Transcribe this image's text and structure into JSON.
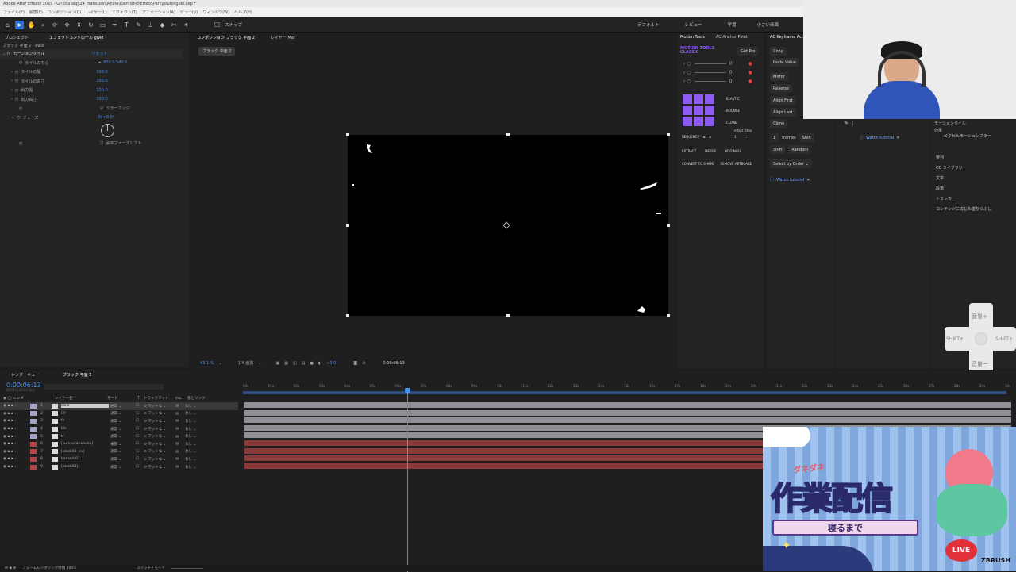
{
  "titlebar": {
    "title": "Adobe After Effects 2025 - G:\\Kita aiqg24 matsuzan\\AEefe\\Kamisinio\\Effect\\Parsys\\uiengeki.aep *"
  },
  "menu": [
    "ファイル(F)",
    "編集(E)",
    "コンポジション(C)",
    "レイヤー(L)",
    "エフェクト(T)",
    "アニメーション(A)",
    "ビュー(V)",
    "ウィンドウ(W)",
    "ヘルプ(H)"
  ],
  "toolbar": {
    "snap_label": "スナップ",
    "workspaces": [
      "デフォルト",
      "レビュー",
      "学習",
      "小さい画面"
    ]
  },
  "project_panel": {
    "tab1": "プロジェクト",
    "tab2": "エフェクトコントロール gwlo",
    "layer_path": "ブラック 平面 2 · ewlo"
  },
  "effect": {
    "name": "モーションタイル",
    "reset": "リセット",
    "props": [
      {
        "label": "タイルの中心",
        "value": "800.0,540.0"
      },
      {
        "label": "タイルの幅",
        "value": "100.0"
      },
      {
        "label": "タイルの高さ",
        "value": "100.0"
      },
      {
        "label": "出力幅",
        "value": "100.0"
      },
      {
        "label": "出力高さ",
        "value": "100.0"
      }
    ],
    "mirror": "ミラーエッジ",
    "phase_label": "フェーズ",
    "phase_value": "0x+0.0°",
    "hshift": "水平フェーズシフト"
  },
  "comp_panel": {
    "tab": "コンポジション ブラック 平面 2",
    "layer_tab": "レイヤー Mar",
    "chip": "ブラック 平面 2",
    "zoom": "43.1 %",
    "res": "1/4 画質",
    "exposure": "+0.0",
    "time": "0:00:06:13"
  },
  "motion_tools": {
    "tabs": [
      "Motion Tools",
      "AC Anchor Point"
    ],
    "brand": "MOTION TOOLS CLASSIC",
    "getpro": "Get Pro",
    "sliders": [
      "0",
      "0",
      "0"
    ],
    "side_labels": [
      "ELASTIC",
      "BOUNCE",
      "CLONE"
    ],
    "sequence": "SEQUENCE",
    "offset": "offset",
    "step": "step",
    "offset_val": "1",
    "step_val": "1",
    "row1": [
      "EXTRACT",
      "MERGE",
      "ADD NULL"
    ],
    "row2": [
      "CONVERT TO SHAPE",
      "REMOVE ARTBOARD"
    ]
  },
  "keyframe": {
    "tab": "AC Keyframe Act",
    "buttons": [
      "Copy",
      "Paste Value",
      "Mirror",
      "Reverse",
      "Align First",
      "Align Last",
      "Clone"
    ],
    "frames": "frames",
    "shift": "Shift",
    "random": "Random",
    "select_by": "Select by Order",
    "tutorial": "Watch tutorial",
    "frames_num": "1"
  },
  "extra_panel": {
    "tutorial": "Watch tutorial"
  },
  "right_list": {
    "header": "モーションタイル",
    "sub1": "効果",
    "sub2": "ピクセルモーションブラー",
    "items": [
      "整列",
      "CC ライブラリ",
      "文字",
      "段落",
      "トラッカー",
      "コンテンツに応じた塗りつぶし"
    ]
  },
  "overlay_pad": {
    "up": "音量+",
    "down": "音量ー",
    "left": "SHIFT+",
    "right": "SHIFT+"
  },
  "timeline": {
    "tab1": "レンダーキュー",
    "tab2": "ブラック 平面 2",
    "timecode": "0:00:06:13",
    "frame_info": "00193 (30.00 fps)",
    "col_layer": "レイヤー名",
    "col_mode": "モード",
    "col_t": "T",
    "col_matte": "トラックマット",
    "col_parent": "親とリンク",
    "ticks": [
      "00s",
      "01s",
      "02s",
      "03s",
      "04s",
      "05s",
      "06s",
      "07s",
      "08s",
      "09s",
      "10s",
      "11s",
      "12s",
      "13s",
      "14s",
      "15s",
      "16s",
      "17s",
      "18s",
      "19s",
      "20s",
      "21s",
      "22s",
      "23s",
      "24s",
      "25s",
      "26s",
      "27s",
      "28s",
      "29s",
      "30s"
    ],
    "layers": [
      {
        "num": "1",
        "name": "ewlo",
        "mode": "通常",
        "matte": "マットな",
        "parent": "なし",
        "color": "#a3a3c7"
      },
      {
        "num": "2",
        "name": "CP",
        "mode": "通常",
        "matte": "マットな",
        "parent": "なし",
        "color": "#a3a3c7"
      },
      {
        "num": "3",
        "name": "fh",
        "mode": "通常",
        "matte": "マットな",
        "parent": "なし",
        "color": "#a3a3c7"
      },
      {
        "num": "4",
        "name": "ble",
        "mode": "通常",
        "matte": "マットな",
        "parent": "なし",
        "color": "#a3a3c7"
      },
      {
        "num": "5",
        "name": "tf",
        "mode": "通常",
        "matte": "マットな",
        "parent": "なし",
        "color": "#a3a3c7"
      },
      {
        "num": "6",
        "name": "[kurokutarunoizu]",
        "mode": "乗算",
        "matte": "マットな",
        "parent": "なし",
        "color": "#b54545"
      },
      {
        "num": "7",
        "name": "[black03 .ex]",
        "mode": "通常",
        "matte": "マットな",
        "parent": "なし",
        "color": "#b54545"
      },
      {
        "num": "8",
        "name": "bamack01",
        "mode": "通常",
        "matte": "マットな",
        "parent": "なし",
        "color": "#b54545"
      },
      {
        "num": "9",
        "name": "[black02]",
        "mode": "通常",
        "matte": "マットな",
        "parent": "なし",
        "color": "#b54545"
      }
    ],
    "footer_render": "フレームレンダリング時間 30ms",
    "footer_switch": "スイッチ / モード"
  },
  "stream_banner": {
    "kana": "ダネダネ",
    "title": "作業配信",
    "sub": "寝るまで",
    "live": "LIVE",
    "brand": "ZBRUSH"
  }
}
